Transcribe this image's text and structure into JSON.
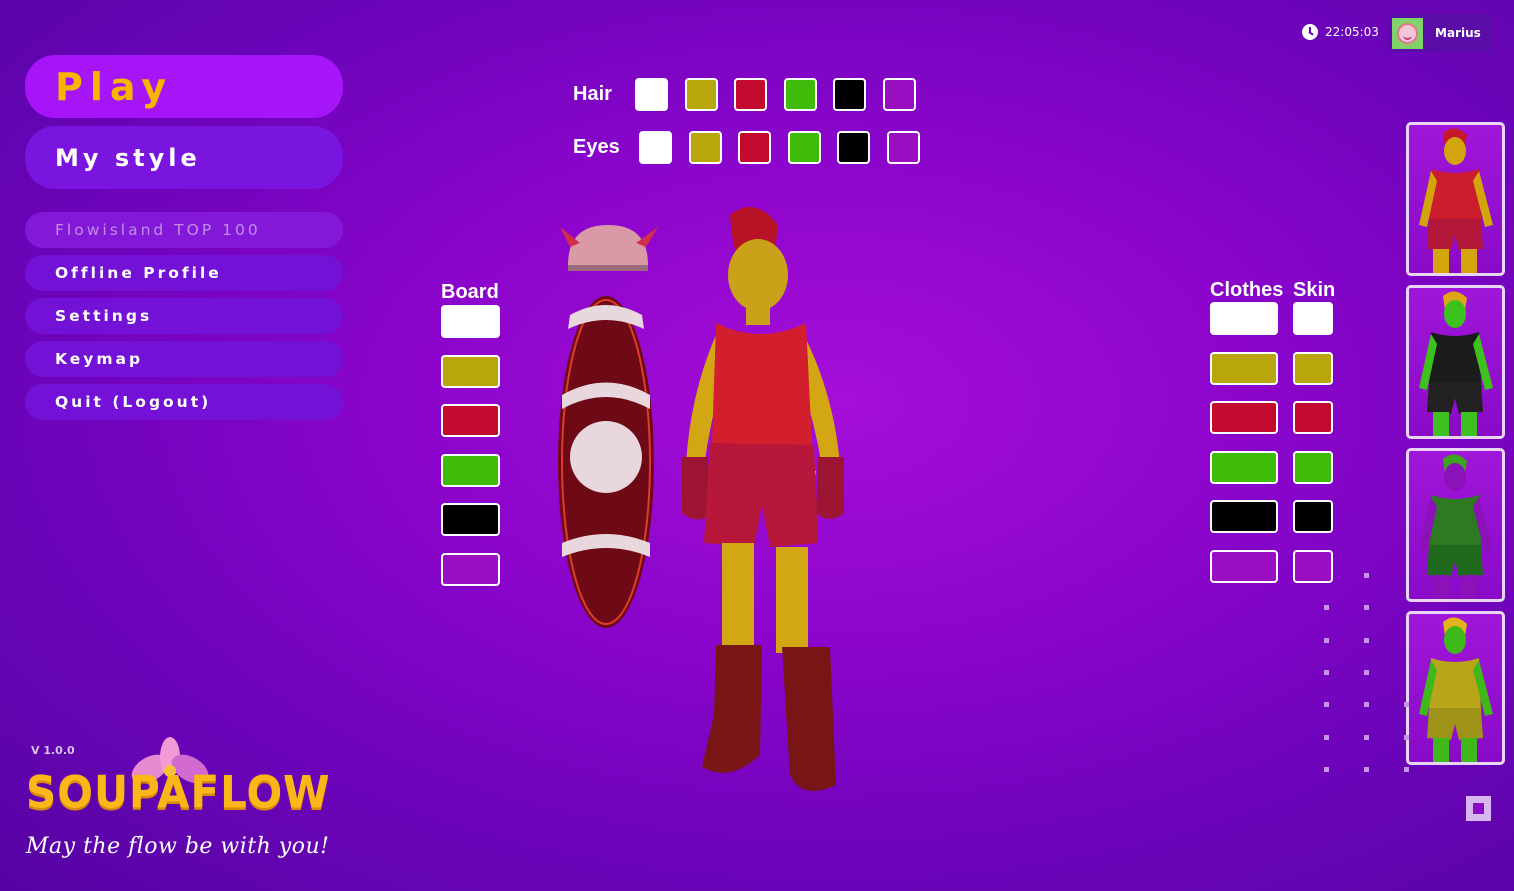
{
  "menu": {
    "play_label": "Play",
    "style_label": "My style",
    "items": [
      {
        "label": "Flowisland TOP 100",
        "disabled": true
      },
      {
        "label": "Offline Profile",
        "disabled": false
      },
      {
        "label": "Settings",
        "disabled": false
      },
      {
        "label": "Keymap",
        "disabled": false
      },
      {
        "label": "Quit (Logout)",
        "disabled": false
      }
    ]
  },
  "header": {
    "time": "22:05:03",
    "clock_icon": "clock-icon",
    "user_name": "Marius",
    "avatar_icon": "smiley-avatar"
  },
  "customizer": {
    "hair_label": "Hair",
    "eyes_label": "Eyes",
    "board_label": "Board",
    "clothes_label": "Clothes",
    "skin_label": "Skin",
    "palette": [
      "#ffffff",
      "#b9a60c",
      "#c30a2f",
      "#3fbb0a",
      "#000000",
      "#9a0fc2"
    ]
  },
  "footer": {
    "version": "V 1.0.0",
    "logo": "SOUPAFLOW",
    "tagline": "May the flow be with you!"
  },
  "skins": [
    {
      "name": "red-outfit",
      "skin": "#d4a40c",
      "shirt": "#cc1d2e",
      "pants": "#b3173a",
      "hair": "#c6172b"
    },
    {
      "name": "black-peace-outfit",
      "skin": "#3dc21d",
      "shirt": "#1b1b1b",
      "pants": "#222222",
      "hair": "#e0a516"
    },
    {
      "name": "green-purple-outfit",
      "skin": "#8a12b8",
      "shirt": "#2e7a22",
      "pants": "#1f6a1c",
      "hair": "#3aa51c"
    },
    {
      "name": "yellow-outfit",
      "skin": "#3fb81a",
      "shirt": "#b8a51a",
      "pants": "#9e9318",
      "hair": "#e3b21d"
    }
  ],
  "colors": {
    "accent": "#a515f7",
    "play_text": "#f5b400",
    "logo": "#fbb618"
  }
}
